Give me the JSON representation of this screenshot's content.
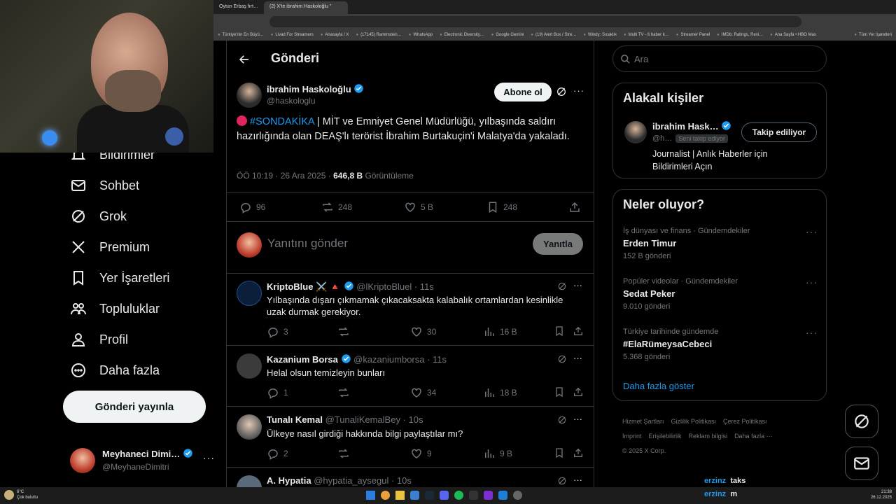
{
  "browser": {
    "tabs": [
      "Oytun Erbaş fırt…",
      "(2) X'te ibrahim Haskoloğlu \""
    ],
    "bookmarks": [
      "Türkiye'nin En Büyü…",
      "Livad For Streamers",
      "Anasayfa / X",
      "(17145) Rammstein…",
      "WhatsApp",
      "Electronic Diversity…",
      "Google Gemini",
      "(19) Alert Box / Stre…",
      "Windy: Sıcaklık",
      "Multi TV - 6 haber k…",
      "Streamer Panel",
      "IMDb: Ratings, Revi…",
      "Ana Sayfa • HBO Max"
    ],
    "all_bookmarks": "Tüm Yer İşaretleri"
  },
  "nav": {
    "items": [
      "Bildirimler",
      "Sohbet",
      "Grok",
      "Premium",
      "Yer İşaretleri",
      "Topluluklar",
      "Profil",
      "Daha fazla"
    ],
    "post_button": "Gönderi yayınla",
    "account_name": "Meyhaneci Dimi…",
    "account_handle": "@MeyhaneDimitri"
  },
  "header": {
    "title": "Gönderi"
  },
  "post": {
    "author": "ibrahim Haskoloğlu",
    "handle": "@haskologlu",
    "subscribe": "Abone ol",
    "hashtag": "#SONDAKİKA",
    "text": " | MİT ve Emniyet Genel Müdürlüğü, yılbaşında saldırı hazırlığında olan DEAŞ'lı terörist İbrahim Burtakuçin'i Malatya'da yakaladı.",
    "time": "ÖÖ 10:19 · 26 Ara 2025 · ",
    "views": "646,8 B",
    "views_label": " Görüntüleme",
    "replies": "96",
    "reposts": "248",
    "likes": "5 B",
    "bookmarks": "248"
  },
  "composer": {
    "placeholder": "Yanıtını gönder",
    "button": "Yanıtla"
  },
  "replies": [
    {
      "name": "KriptoBlue ⚔️ 🔺",
      "handle": "@lKriptoBluel · 11s",
      "text": "Yılbaşında dışarı çıkmamak çıkacaksakta kalabalık ortamlardan kesinlikle uzak durmak gerekiyor.",
      "replies": "3",
      "reposts": "",
      "likes": "30",
      "views": "16 B"
    },
    {
      "name": "Kazanium Borsa",
      "handle": "@kazaniumborsa · 11s",
      "text": "Helal olsun temizleyin bunları",
      "replies": "1",
      "reposts": "",
      "likes": "34",
      "views": "18 B"
    },
    {
      "name": "Tunalı Kemal",
      "handle": "@TunaliKemalBey · 10s",
      "text": "Ülkeye nasıl girdiği hakkında bilgi paylaştılar mı?",
      "replies": "2",
      "reposts": "",
      "likes": "9",
      "views": "9 B"
    },
    {
      "name": "A. Hypatia",
      "handle": "@hypatia_aysegul · 10s",
      "text": "",
      "replies": "",
      "reposts": "",
      "likes": "",
      "views": ""
    }
  ],
  "search": {
    "placeholder": "Ara"
  },
  "related": {
    "title": "Alakalı kişiler",
    "name": "ibrahim Hask…",
    "handle": "@h…",
    "follows_you": "Seni takip ediyor",
    "follow_button": "Takip ediliyor",
    "bio": "Journalist | Anlık Haberler için Bildirimleri Açın"
  },
  "trends": {
    "title": "Neler oluyor?",
    "items": [
      {
        "meta": "İş dünyası ve finans · Gündemdekiler",
        "name": "Erden Timur",
        "count": "152 B gönderi"
      },
      {
        "meta": "Popüler videolar · Gündemdekiler",
        "name": "Sedat Peker",
        "count": "9.010 gönderi"
      },
      {
        "meta": "Türkiye tarihinde gündemde",
        "name": "#ElaRümeysaCebeci",
        "count": "5.368 gönderi"
      }
    ],
    "show_more": "Daha fazla göster"
  },
  "footer": [
    "Hizmet Şartları",
    "Gizlilik Politikası",
    "Çerez Politikası",
    "Imprint",
    "Erişilebilirlik",
    "Reklam bilgisi",
    "Daha fazla ···",
    "© 2025 X Corp."
  ],
  "overlay": {
    "line1_user": "erzinz",
    "line1_msg": "taks",
    "line2_user": "erzinz",
    "line2_msg": "m"
  },
  "taskbar": {
    "weather_temp": "6°C",
    "weather_desc": "Çok bulutlu",
    "time": "21:38",
    "date": "26.12.2025"
  },
  "colors": {
    "accent": "#1d9bf0",
    "background": "#000000",
    "border": "#2f3336",
    "muted": "#71767b"
  }
}
